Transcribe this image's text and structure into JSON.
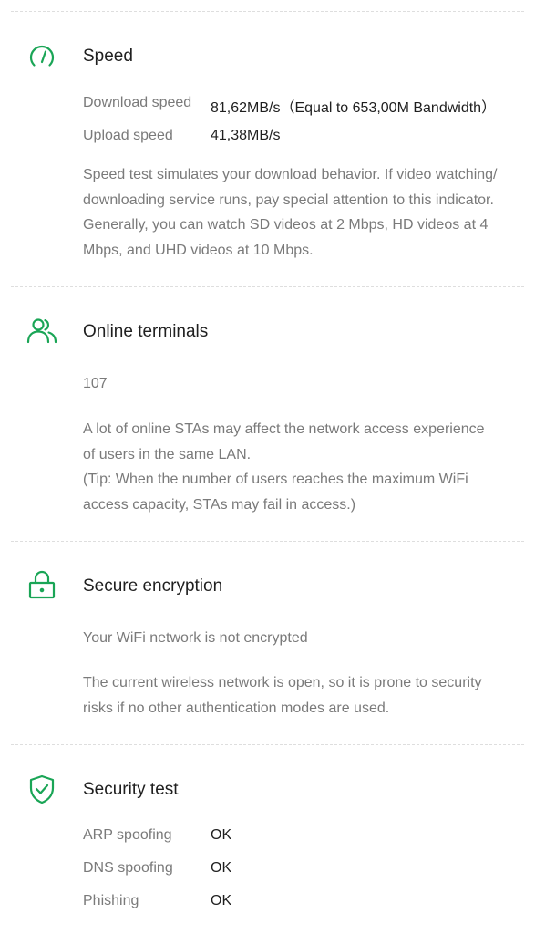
{
  "accent_color": "#1aa556",
  "speed": {
    "icon": "speedometer-icon",
    "title": "Speed",
    "download_label": "Download speed",
    "download_value": "81,62MB/s（Equal to 653,00M Bandwidth）",
    "upload_label": "Upload speed",
    "upload_value": "41,38MB/s",
    "description_lines": [
      "Speed test simulates your download behavior. If video watching/",
      "downloading service runs, pay special attention to this indicator.",
      "Generally, you can watch SD videos at 2 Mbps, HD videos at 4",
      "Mbps, and UHD videos at 10 Mbps."
    ]
  },
  "online_terminals": {
    "icon": "users-icon",
    "title": "Online terminals",
    "count": "107",
    "description_lines": [
      "A lot of online STAs may affect the network access experience",
      "of users in the same LAN.",
      "(Tip: When the number of users reaches the maximum WiFi",
      "access capacity, STAs may fail in access.)"
    ]
  },
  "secure_encryption": {
    "icon": "lock-icon",
    "title": "Secure encryption",
    "status": "Your WiFi network is not encrypted",
    "description_lines": [
      "The current wireless network is open, so it is prone to security",
      "risks if no other authentication modes are used."
    ]
  },
  "security_test": {
    "icon": "shield-check-icon",
    "title": "Security test",
    "items": [
      {
        "label": "ARP spoofing",
        "value": "OK"
      },
      {
        "label": "DNS spoofing",
        "value": "OK"
      },
      {
        "label": "Phishing",
        "value": "OK"
      }
    ]
  }
}
